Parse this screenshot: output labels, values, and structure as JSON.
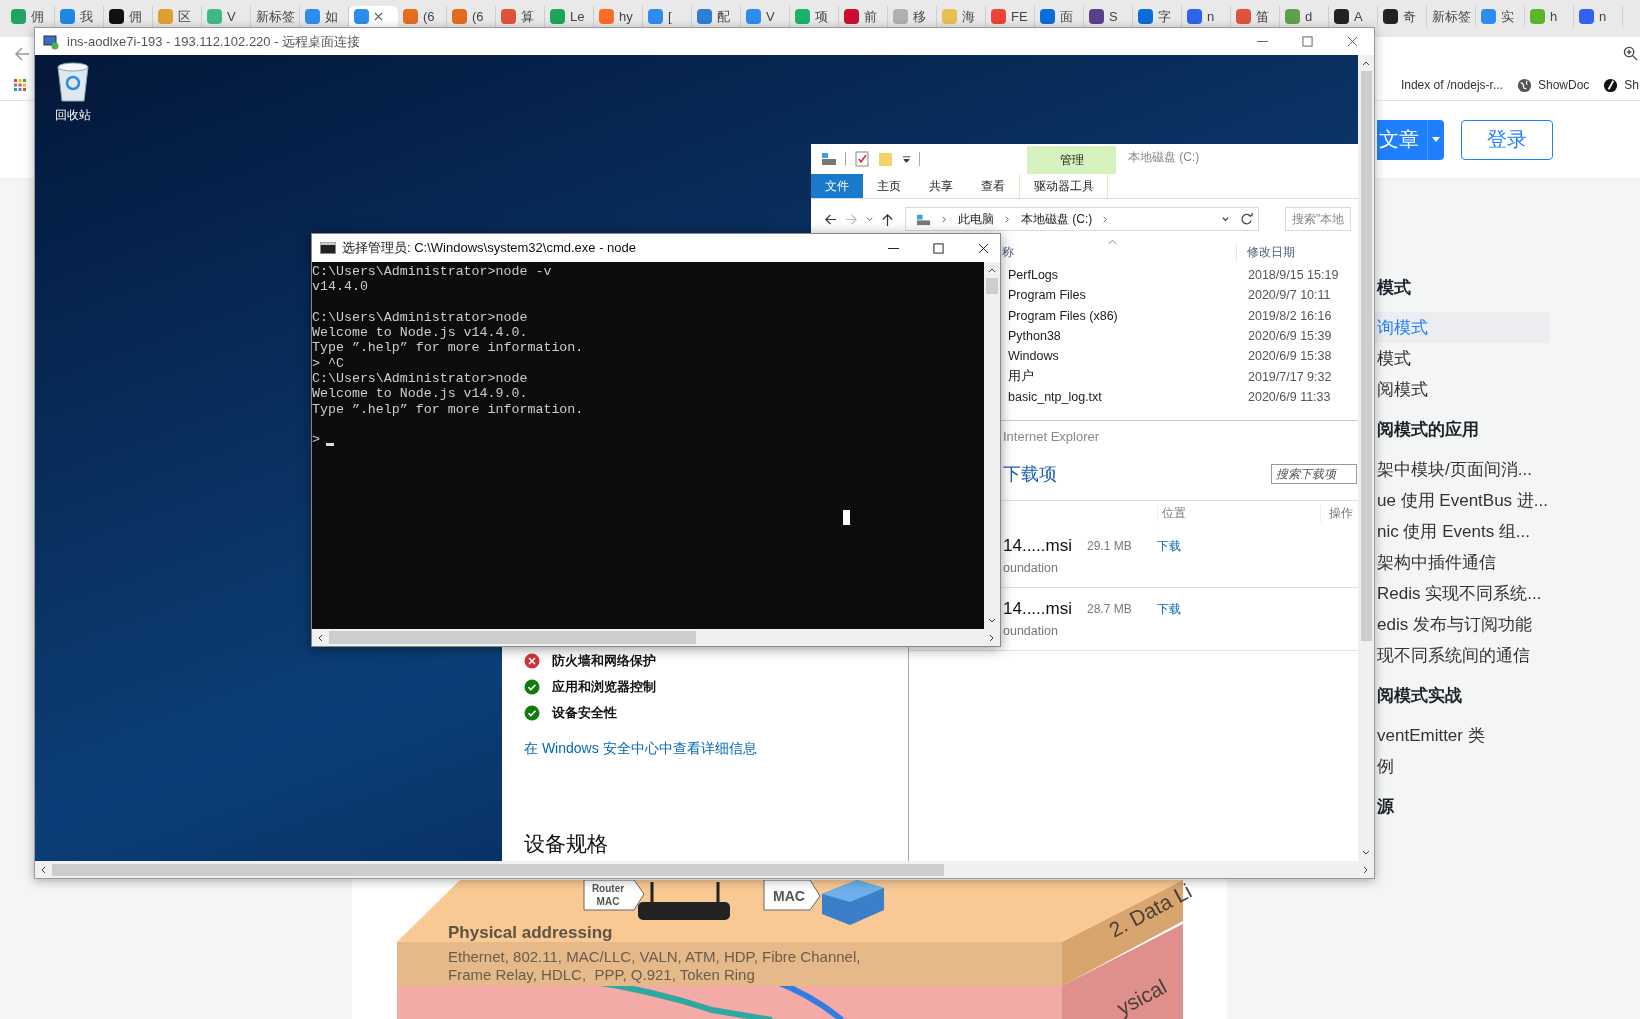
{
  "browser": {
    "tabs": [
      {
        "label": "佣",
        "color": "#21a366",
        "selected": false
      },
      {
        "label": "我",
        "color": "#1e88e5",
        "selected": false
      },
      {
        "label": "佣",
        "color": "#111111",
        "selected": false
      },
      {
        "label": "区",
        "color": "#e0a030",
        "selected": false
      },
      {
        "label": "V",
        "color": "#41b883",
        "selected": false
      },
      {
        "label": "新标签",
        "selected": false
      },
      {
        "label": "如",
        "color": "#2d8cf0",
        "selected": false
      },
      {
        "color": "#2d8cf0",
        "selected": true
      },
      {
        "label": "(6",
        "color": "#e36c1f",
        "selected": false
      },
      {
        "label": "(6",
        "color": "#e36c1f",
        "selected": false
      },
      {
        "label": "算",
        "color": "#e0533c",
        "selected": false
      },
      {
        "label": "Le",
        "color": "#1da657",
        "selected": false
      },
      {
        "label": "hy",
        "color": "#fc6d26",
        "selected": false
      },
      {
        "label": "[",
        "color": "#2d8cf0",
        "selected": false
      },
      {
        "label": "配",
        "color": "#2e7dd7",
        "selected": false
      },
      {
        "label": "V",
        "color": "#2d8cf0",
        "selected": false
      },
      {
        "label": "项",
        "color": "#19b36b",
        "selected": false
      },
      {
        "label": "前",
        "color": "#c8102e",
        "selected": false
      },
      {
        "label": "移",
        "color": "#b0b0b0",
        "selected": false
      },
      {
        "label": "海",
        "color": "#e8c050",
        "selected": false
      },
      {
        "label": "FE",
        "color": "#ee4433",
        "selected": false
      },
      {
        "label": "面",
        "color": "#0a6dd9",
        "selected": false
      },
      {
        "label": "S",
        "color": "#5b3f8c",
        "selected": false
      },
      {
        "label": "字",
        "color": "#0a6dd9",
        "selected": false
      },
      {
        "label": "n",
        "color": "#3062ef",
        "selected": false
      },
      {
        "label": "笛",
        "color": "#e0533c",
        "selected": false
      },
      {
        "label": "d",
        "color": "#5fa04e",
        "selected": false
      },
      {
        "label": "A",
        "color": "#222222",
        "selected": false
      },
      {
        "label": "奇",
        "color": "#222222",
        "selected": false
      },
      {
        "label": "新标签",
        "selected": false
      },
      {
        "label": "实",
        "color": "#2d8cf0",
        "selected": false
      },
      {
        "label": "h",
        "color": "#5ab52c",
        "selected": false
      },
      {
        "label": "n",
        "color": "#3062ef",
        "selected": false
      }
    ],
    "bookmarks": [
      {
        "label": "Index of /nodejs-r...",
        "kind": "none"
      },
      {
        "label": "ShowDoc",
        "kind": "globe"
      },
      {
        "label": "Sh",
        "kind": "disc"
      }
    ],
    "write_button": "文章",
    "login_button": "登录",
    "toc": [
      {
        "text": "模式",
        "kind": "heading",
        "selected": false
      },
      {
        "text": "询模式",
        "kind": "item",
        "selected": true
      },
      {
        "text": "模式",
        "kind": "item",
        "selected": false
      },
      {
        "text": "阅模式",
        "kind": "item",
        "selected": false
      },
      {
        "text": "阅模式的应用",
        "kind": "heading",
        "selected": false
      },
      {
        "text": "架中模块/页面间消...",
        "kind": "item",
        "selected": false
      },
      {
        "text": "ue 使用 EventBus 进...",
        "kind": "item",
        "selected": false
      },
      {
        "text": "nic 使用 Events 组...",
        "kind": "item",
        "selected": false
      },
      {
        "text": "架构中插件通信",
        "kind": "item",
        "selected": false
      },
      {
        "text": "Redis 实现不同系统...",
        "kind": "item",
        "selected": false
      },
      {
        "text": "edis 发布与订阅功能",
        "kind": "item",
        "selected": false
      },
      {
        "text": "现不同系统间的通信",
        "kind": "item",
        "selected": false
      },
      {
        "text": "阅模式实战",
        "kind": "heading",
        "selected": false
      },
      {
        "text": "ventEmitter 类",
        "kind": "item",
        "selected": false
      },
      {
        "text": "例",
        "kind": "item",
        "selected": false
      },
      {
        "text": "源",
        "kind": "heading",
        "selected": false
      }
    ]
  },
  "remote_desktop": {
    "title": "ins-aodlxe7i-193 - 193.112.102.220 - 远程桌面连接",
    "desktop_icons": [
      {
        "label": "回收站"
      }
    ],
    "explorer": {
      "context_tab": "管理",
      "location": "本地磁盘 (C:)",
      "ribbon_tabs": [
        {
          "label": "文件",
          "selected": true
        },
        {
          "label": "主页",
          "selected": false
        },
        {
          "label": "共享",
          "selected": false
        },
        {
          "label": "查看",
          "selected": false
        },
        {
          "label": "驱动器工具",
          "selected": false
        }
      ],
      "breadcrumbs": [
        "此电脑",
        "本地磁盘 (C:)"
      ],
      "search": {
        "placeholder": "搜索\"本地"
      },
      "columns": [
        "称",
        "修改日期"
      ],
      "rows": [
        {
          "name": "PerfLogs",
          "date": "2018/9/15 15:19"
        },
        {
          "name": "Program Files",
          "date": "2020/9/7 10:11"
        },
        {
          "name": "Program Files (x86)",
          "date": "2019/8/2 16:16"
        },
        {
          "name": "Python38",
          "date": "2020/6/9 15:39"
        },
        {
          "name": "Windows",
          "date": "2020/6/9 15:38"
        },
        {
          "name": "用户",
          "date": "2019/7/17 9:32"
        },
        {
          "name": "basic_ntp_log.txt",
          "date": "2020/6/9 11:33"
        }
      ]
    },
    "downloads": {
      "app": "Internet Explorer",
      "title": "下载项",
      "search": {
        "placeholder": "搜索下载项"
      },
      "columns": [
        "位置",
        "操作"
      ],
      "items": [
        {
          "name": "14.....msi",
          "size": "29.1 MB",
          "action": "下载",
          "source": "oundation"
        },
        {
          "name": "14.....msi",
          "size": "28.7 MB",
          "action": "下载",
          "source": "oundation"
        }
      ]
    },
    "security": {
      "items": [
        {
          "label": "防火墙和网络保护",
          "kind": "error"
        },
        {
          "label": "应用和浏览器控制",
          "kind": "ok"
        },
        {
          "label": "设备安全性",
          "kind": "ok"
        }
      ],
      "link": "在 Windows 安全中心中查看详细信息",
      "heading": "设备规格"
    },
    "console": {
      "title": "选择管理员: C:\\Windows\\system32\\cmd.exe - node",
      "blocks": [
        {
          "lines": [
            "C:\\Users\\Administrator>node -v",
            "v14.4.0"
          ]
        },
        {
          "lines": [
            "C:\\Users\\Administrator>node",
            "Welcome to Node.js v14.4.0.",
            "Type ”.help” for more information.",
            "> ^C",
            "C:\\Users\\Administrator>node",
            "Welcome to Node.js v14.9.0.",
            "Type ”.help” for more information."
          ]
        }
      ],
      "prompt": ">"
    }
  },
  "figure": {
    "layer_title": "Physical addressing",
    "protocols": [
      "Ethernet, 802.11, MAC/LLC, VALN, ATM, HDP, Fibre Channel,",
      "Frame Relay, HDLC,  PPP, Q.921, Token Ring"
    ],
    "layer_name": "2. Data Li",
    "lower_layer_name": "ysical",
    "router_tag": [
      "Router",
      "MAC"
    ],
    "switch_tag": "MAC"
  }
}
